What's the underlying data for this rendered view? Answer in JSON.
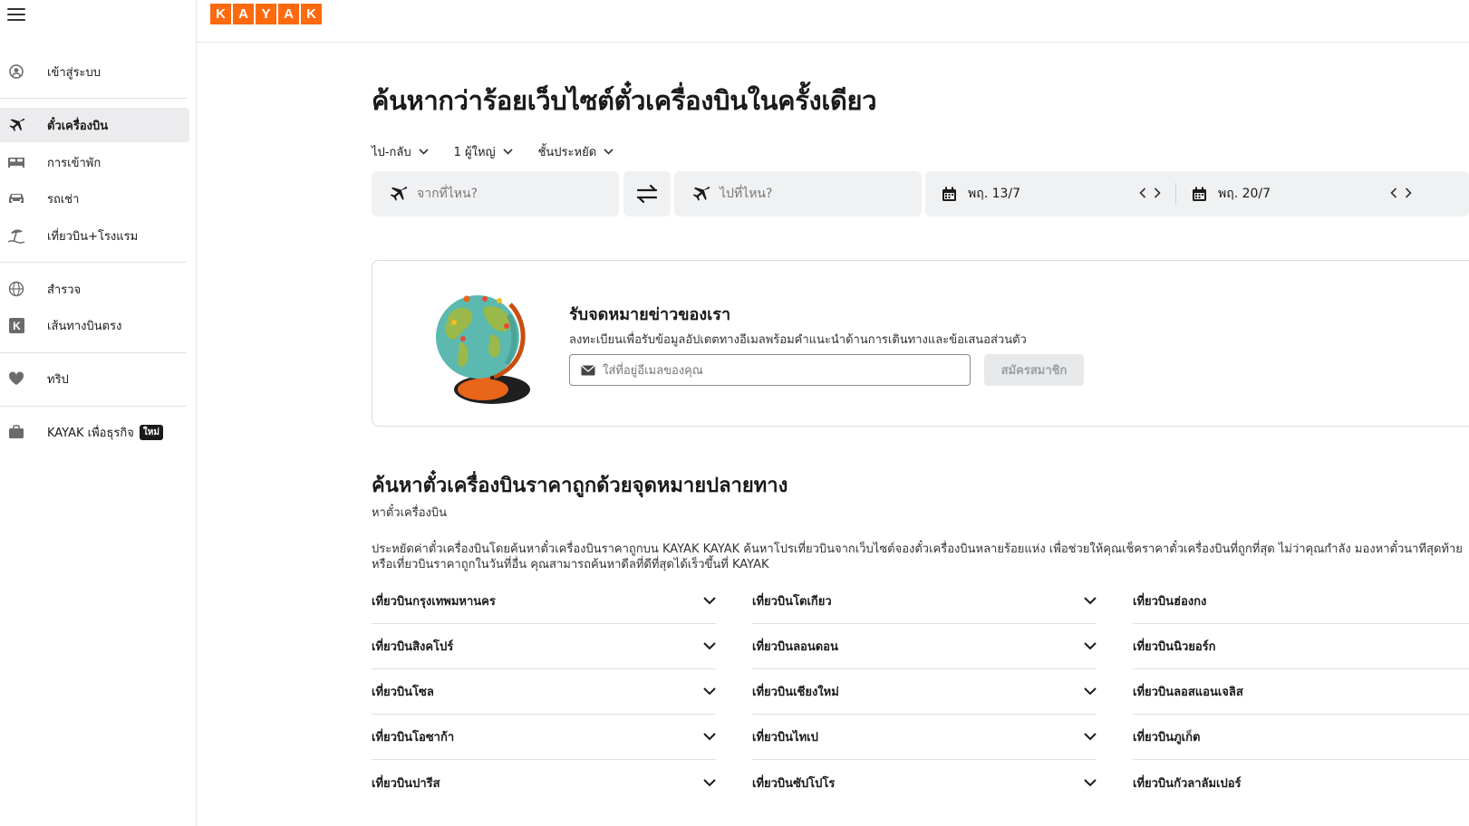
{
  "brand": {
    "logo_letters": [
      "K",
      "A",
      "Y",
      "A",
      "K"
    ],
    "accent": "#ff690f"
  },
  "sidebar": {
    "items": [
      {
        "label": "เข้าสู่ระบบ",
        "icon": "user-circle-icon"
      },
      {
        "label": "ตั๋วเครื่องบิน",
        "icon": "plane-icon",
        "active": true
      },
      {
        "label": "การเข้าพัก",
        "icon": "bed-icon"
      },
      {
        "label": "รถเช่า",
        "icon": "car-icon"
      },
      {
        "label": "เที่ยวบิน+โรงแรม",
        "icon": "beach-umbrella-icon"
      },
      {
        "label": "สำรวจ",
        "icon": "globe-icon"
      },
      {
        "label": "เส้นทางบินตรง",
        "icon": "kayak-k-icon"
      },
      {
        "label": "ทริป",
        "icon": "heart-icon"
      },
      {
        "label": "KAYAK เพื่อธุรกิจ",
        "icon": "briefcase-icon",
        "badge": "ใหม่"
      }
    ]
  },
  "hero": {
    "title": "ค้นหากว่าร้อยเว็บไซต์ตั๋วเครื่องบินในครั้งเดียว",
    "options": {
      "trip_type": "ไป-กลับ",
      "passengers": "1 ผู้ใหญ่",
      "cabin": "ชั้นประหยัด"
    },
    "search": {
      "from_placeholder": "จากที่ไหน?",
      "to_placeholder": "ไปที่ไหน?",
      "depart_date": "พฤ. 13/7",
      "return_date": "พฤ. 20/7"
    }
  },
  "newsletter": {
    "title": "รับจดหมายข่าวของเรา",
    "subtitle": "ลงทะเบียนเพื่อรับข้อมูลอัปเดตทางอีเมลพร้อมคำแนะนำด้านการเดินทางและข้อเสนอส่วนตัว",
    "email_placeholder": "ใส่ที่อยู่อีเมลของคุณ",
    "subscribe_label": "สมัครสมาชิก"
  },
  "destinations_section": {
    "title": "ค้นหาตั๋วเครื่องบินราคาถูกด้วยจุดหมายปลายทาง",
    "subtitle": "หาตั๋วเครื่องบิน",
    "description": "ประหยัดค่าตั๋วเครื่องบินโดยค้นหาตั๋วเครื่องบินราคาถูกบน KAYAK KAYAK ค้นหาโปรเที่ยวบินจากเว็บไซต์จองตั๋วเครื่องบินหลายร้อยแห่ง เพื่อช่วยให้คุณเช็คราคาตั๋วเครื่องบินที่ถูกที่สุด ไม่ว่าคุณกำลัง มองหาตั๋วนาทีสุดท้ายหรือเที่ยวบินราคาถูกในวันที่อื่น คุณสามารถค้นหาดีลที่ดีที่สุดได้เร็วขึ้นที่ KAYAK",
    "columns": [
      [
        "เที่ยวบินกรุงเทพมหานคร",
        "เที่ยวบินสิงคโปร์",
        "เที่ยวบินโซล",
        "เที่ยวบินโอซาก้า",
        "เที่ยวบินปารีส"
      ],
      [
        "เที่ยวบินโตเกียว",
        "เที่ยวบินลอนดอน",
        "เที่ยวบินเชียงใหม่",
        "เที่ยวบินไทเป",
        "เที่ยวบินซัปโปโร"
      ],
      [
        "เที่ยวบินฮ่องกง",
        "เที่ยวบินนิวยอร์ก",
        "เที่ยวบินลอสแอนเจลิส",
        "เที่ยวบินภูเก็ต",
        "เที่ยวบินกัวลาลัมเปอร์"
      ]
    ]
  }
}
